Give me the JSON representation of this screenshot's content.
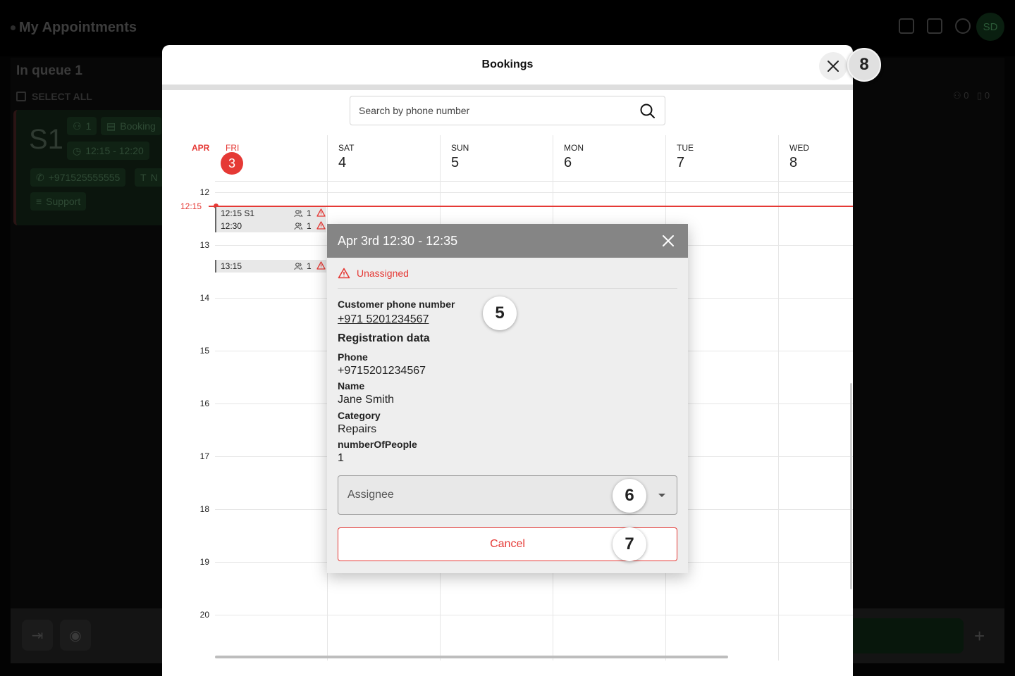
{
  "background": {
    "app_title": "My Appointments",
    "avatar_initials": "SD",
    "queue_title": "In queue 1",
    "select_all": "SELECT ALL",
    "card": {
      "service_code": "S1",
      "people": "1",
      "type": "Booking",
      "time": "12:15 - 12:20",
      "phone": "+971525555555",
      "extra": "N",
      "category": "Support"
    },
    "right_counts": {
      "people": "0",
      "docs": "0"
    }
  },
  "modal": {
    "title": "Bookings",
    "close_icon": "close-icon"
  },
  "search": {
    "placeholder": "Search by phone number",
    "icon": "search-icon"
  },
  "calendar": {
    "month": "APR",
    "days": [
      {
        "name": "FRI",
        "num": "3",
        "today": true
      },
      {
        "name": "SAT",
        "num": "4"
      },
      {
        "name": "SUN",
        "num": "5"
      },
      {
        "name": "MON",
        "num": "6"
      },
      {
        "name": "TUE",
        "num": "7"
      },
      {
        "name": "WED",
        "num": "8"
      }
    ],
    "hours": [
      "12",
      "13",
      "14",
      "15",
      "16",
      "17",
      "18",
      "19",
      "20"
    ],
    "now_label": "12:15",
    "events": [
      {
        "label": "12:15 S1",
        "count": "1"
      },
      {
        "label": "12:30",
        "count": "1"
      },
      {
        "label": "13:15",
        "count": "1"
      }
    ]
  },
  "popup": {
    "title": "Apr 3rd 12:30 - 12:35",
    "status": "Unassigned",
    "customer_phone_label": "Customer phone number",
    "customer_phone": "+971 5201234567",
    "registration_heading": "Registration data",
    "fields": [
      {
        "label": "Phone",
        "value": "+9715201234567"
      },
      {
        "label": "Name",
        "value": "Jane Smith"
      },
      {
        "label": "Category",
        "value": "Repairs"
      },
      {
        "label": "numberOfPeople",
        "value": "1"
      }
    ],
    "assignee_placeholder": "Assignee",
    "cancel_label": "Cancel"
  },
  "step_markers": [
    "5",
    "6",
    "7",
    "8"
  ],
  "colors": {
    "accent_red": "#e53935",
    "popup_header": "#858585"
  }
}
